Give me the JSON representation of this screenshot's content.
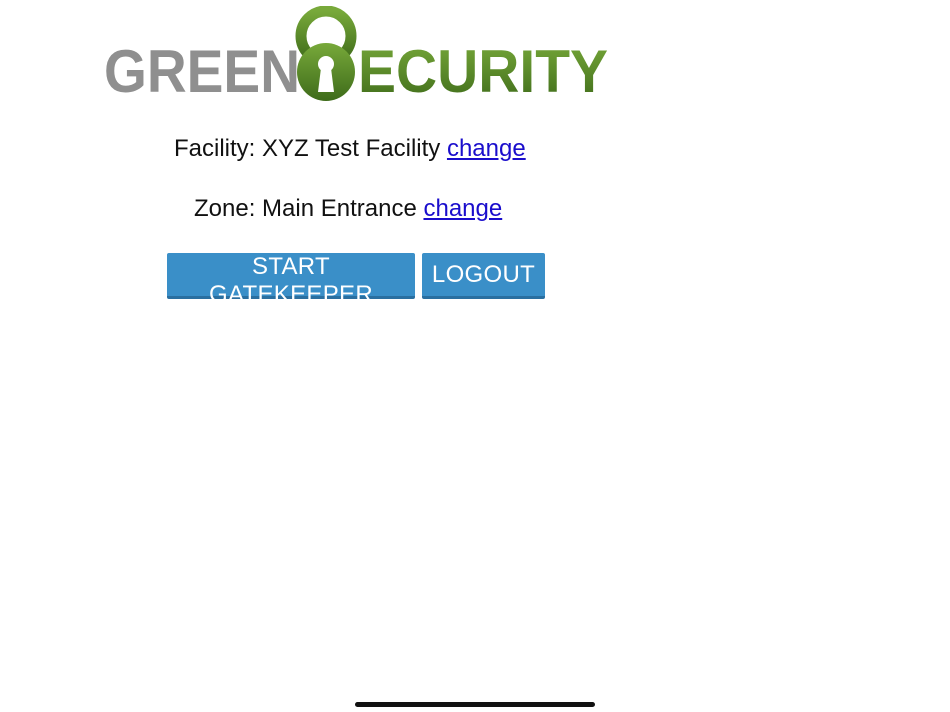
{
  "logo": {
    "word_left": "GREEN",
    "word_right": "ECURITY",
    "gray": "#8f8f8f",
    "green_light": "#78a93a",
    "green_dark": "#3e6b1a"
  },
  "facility": {
    "label": "Facility: XYZ Test Facility",
    "link": "change"
  },
  "zone": {
    "label": "Zone: Main Entrance",
    "link": "change"
  },
  "buttons": {
    "start": "START GATEKEEPER",
    "logout": "LOGOUT"
  }
}
